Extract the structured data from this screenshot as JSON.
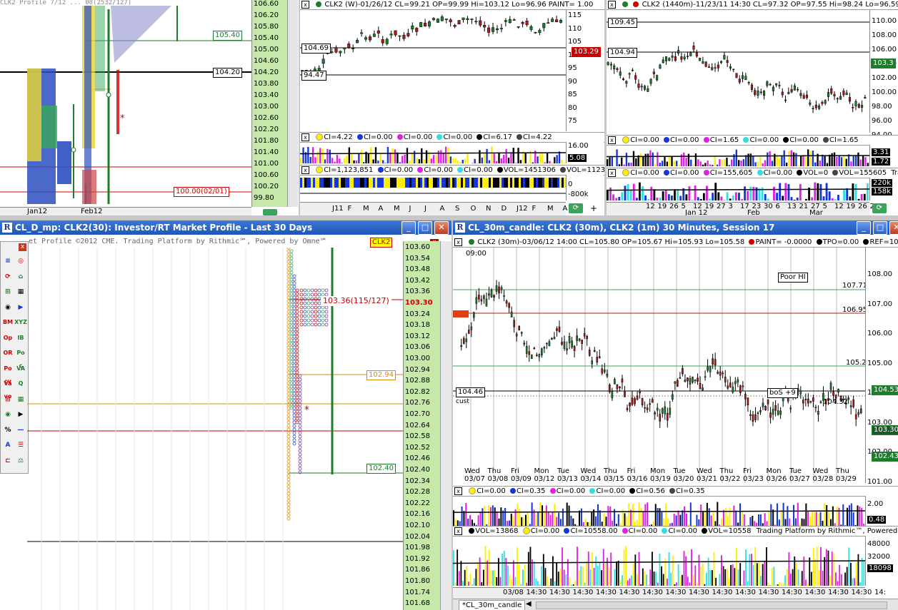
{
  "colors": {
    "title_blue": "#1f56b8",
    "grid_green": "#1e7d2d",
    "level_red": "#cc0000",
    "price_axis": "#c6e8a8"
  },
  "profile_top": {
    "header_text": "CLK2 Profile 7/12 ... 00(2532/127)",
    "price_labels": [
      "106.60",
      "106.20",
      "105.80",
      "105.40",
      "105.00",
      "104.60",
      "104.20",
      "103.80",
      "103.40",
      "103.00",
      "102.60",
      "102.20",
      "101.80",
      "101.40",
      "101.00",
      "100.60",
      "100.20",
      "99.80"
    ],
    "tag_upper": "105.40",
    "tag_mid": "104.20",
    "tag_low": "100.00(02/01)",
    "date_labels": [
      "Jan12",
      "Feb12"
    ]
  },
  "weekly": {
    "status": "CLK2 (W)-01/26/12 CL=99.21 OP=99.99 Hi=103.12 Lo=96.96 PAINT= 1.00",
    "tag_upper": "104.69",
    "tag_lower": "94.47",
    "last_price": "103.29",
    "price_labels": [
      "115",
      "110",
      "105",
      "100",
      "95",
      "90",
      "85",
      "80",
      "75"
    ],
    "ci_status": [
      "CI=4.22",
      "CI=0.00",
      "CI=0.00",
      "CI=0.00",
      "CI=6.17",
      "CI=4.22"
    ],
    "ci_axis": [
      "16.00",
      "5.08"
    ],
    "vol_status": [
      "CI=1,123,851",
      "CI=0.00",
      "CI=0.00",
      "CI=0.00",
      "VOL=1451306",
      "VOL=1123851"
    ],
    "vol_axis": [
      "0",
      "-800k"
    ],
    "date_labels": [
      "J11",
      "F",
      "M",
      "A",
      "M",
      "J",
      "J",
      "A",
      "S",
      "O",
      "N",
      "D",
      "J12",
      "F",
      "M",
      "A"
    ]
  },
  "daily": {
    "status": "CLK2 (1440m)-11/23/11 14:30 CL=97.32 OP=97.55 Hi=98.24 Lo=96.59",
    "tag_upper": "109.45",
    "tag_lower": "104.94",
    "last_price": "103.3",
    "price_labels": [
      "110.00",
      "108.00",
      "106.00",
      "104.00",
      "102.00",
      "100.00",
      "98.00",
      "96.00",
      "94.00"
    ],
    "ci_status": [
      "CI=0.00",
      "CI=0.00",
      "CI=1.65",
      "CI=0.00",
      "CI=0.00",
      "CI=1.65"
    ],
    "ci_axis": [
      "3.31",
      "1.72"
    ],
    "vol_status": [
      "CI=0.00",
      "CI=0.00",
      "CI=155,605",
      "CI=0.00",
      "VOL=0",
      "VOL=155605",
      "Tradin"
    ],
    "vol_axis": [
      "220k",
      "158k"
    ],
    "date_labels": [
      "12",
      "19",
      "26",
      "5",
      "12",
      "19",
      "27",
      "3",
      "17",
      "23",
      "30",
      "6",
      "13",
      "21",
      "27",
      "5",
      "12",
      "19",
      "26",
      "2"
    ],
    "month_labels": [
      "Jan 12",
      "Feb",
      "Mar"
    ]
  },
  "market_profile": {
    "title": "CL_D_mp: CLK2(30): Investor/RT Market Profile - Last 30 Days",
    "banner": "et Profile ©2012 CME. Trading Platform by Rithmic℠, Powered by Omne℠",
    "symbol_tag": "CLK2",
    "poc_tag": "103.36(115/127)",
    "tag_upper": "102.94",
    "tag_lower": "102.40",
    "price_labels": [
      "103.60",
      "103.54",
      "103.48",
      "103.42",
      "103.36",
      "103.30",
      "103.24",
      "103.18",
      "103.12",
      "103.06",
      "103.00",
      "102.94",
      "102.88",
      "102.82",
      "102.76",
      "102.70",
      "102.64",
      "102.58",
      "102.52",
      "102.46",
      "102.40",
      "102.34",
      "102.28",
      "102.22",
      "102.16",
      "102.10",
      "102.04",
      "101.98",
      "101.92",
      "101.86",
      "101.80",
      "101.74",
      "101.68"
    ],
    "current_price": "103.30",
    "tools": [
      "BM",
      "XYZ",
      "Op",
      "IB",
      "OR",
      "Po c",
      "Po cv",
      "VA",
      "Va vo",
      "Q"
    ]
  },
  "candle": {
    "title": "CL_30m_candle: CLK2 (30m), CLK2 (1m) 30 Minutes, Session 17",
    "status": [
      "CLK2 (30m)-03/06/12 14:00 CL=105.80 OP=105.67 Hi=105.93 Lo=105.58",
      "PAINT= -0.0000",
      "TPO=0.00",
      "REF=104."
    ],
    "time_label": "09:00",
    "poor_hi": "Poor HI",
    "level_1": "107.71",
    "level_2": "106.95",
    "level_3": "105.29",
    "level_4": "104.32",
    "tag_left": "104.46",
    "cust_label": "cust",
    "bos_label": "boS +9",
    "price_labels": [
      "108.00",
      "107.00",
      "106.00",
      "105.00",
      "104.00",
      "103.00",
      "102.00",
      "101.00"
    ],
    "tag_dark_1": "104.53",
    "tag_dark_2": "103.30",
    "tag_dark_3": "102.43",
    "day_labels": [
      "Wed",
      "Thu",
      "Fri",
      "Mon",
      "Tue",
      "Wed",
      "Thu",
      "Fri",
      "Mon",
      "Tue",
      "Wed",
      "Thu",
      "Fri",
      "Mon",
      "Tue",
      "Wed",
      "Thu"
    ],
    "date_labels": [
      "03/07",
      "03/08",
      "03/09",
      "03/12",
      "03/13",
      "03/14",
      "03/15",
      "03/16",
      "03/19",
      "03/20",
      "03/21",
      "03/22",
      "03/23",
      "03/26",
      "03/27",
      "03/28",
      "03/29"
    ],
    "ci_status": [
      "CI=0.00",
      "CI=0.35",
      "CI=0.00",
      "CI=0.00",
      "CI=0.56",
      "CI=0.35"
    ],
    "ci_axis": [
      "2.00",
      "0.48"
    ],
    "vol_status": [
      "VOL=13868",
      "CI=0.00",
      "CI=10558.00",
      "CI=0.00",
      "CI=0.00",
      "VOL=10558",
      "Trading Platform by Rithmic™, Powered by O"
    ],
    "vol_axis": [
      "48000",
      "32000",
      "18098"
    ],
    "time_labels": [
      "03/08",
      "14:30",
      "14:30",
      "14:30",
      "14:30",
      "14:30",
      "14:30",
      "14:30",
      "14:30",
      "14:30",
      "14:30",
      "14:30",
      "14:30",
      "14:30",
      "14:30",
      "14:30",
      "14:"
    ],
    "tab_label": "*CL_30m_candle"
  }
}
